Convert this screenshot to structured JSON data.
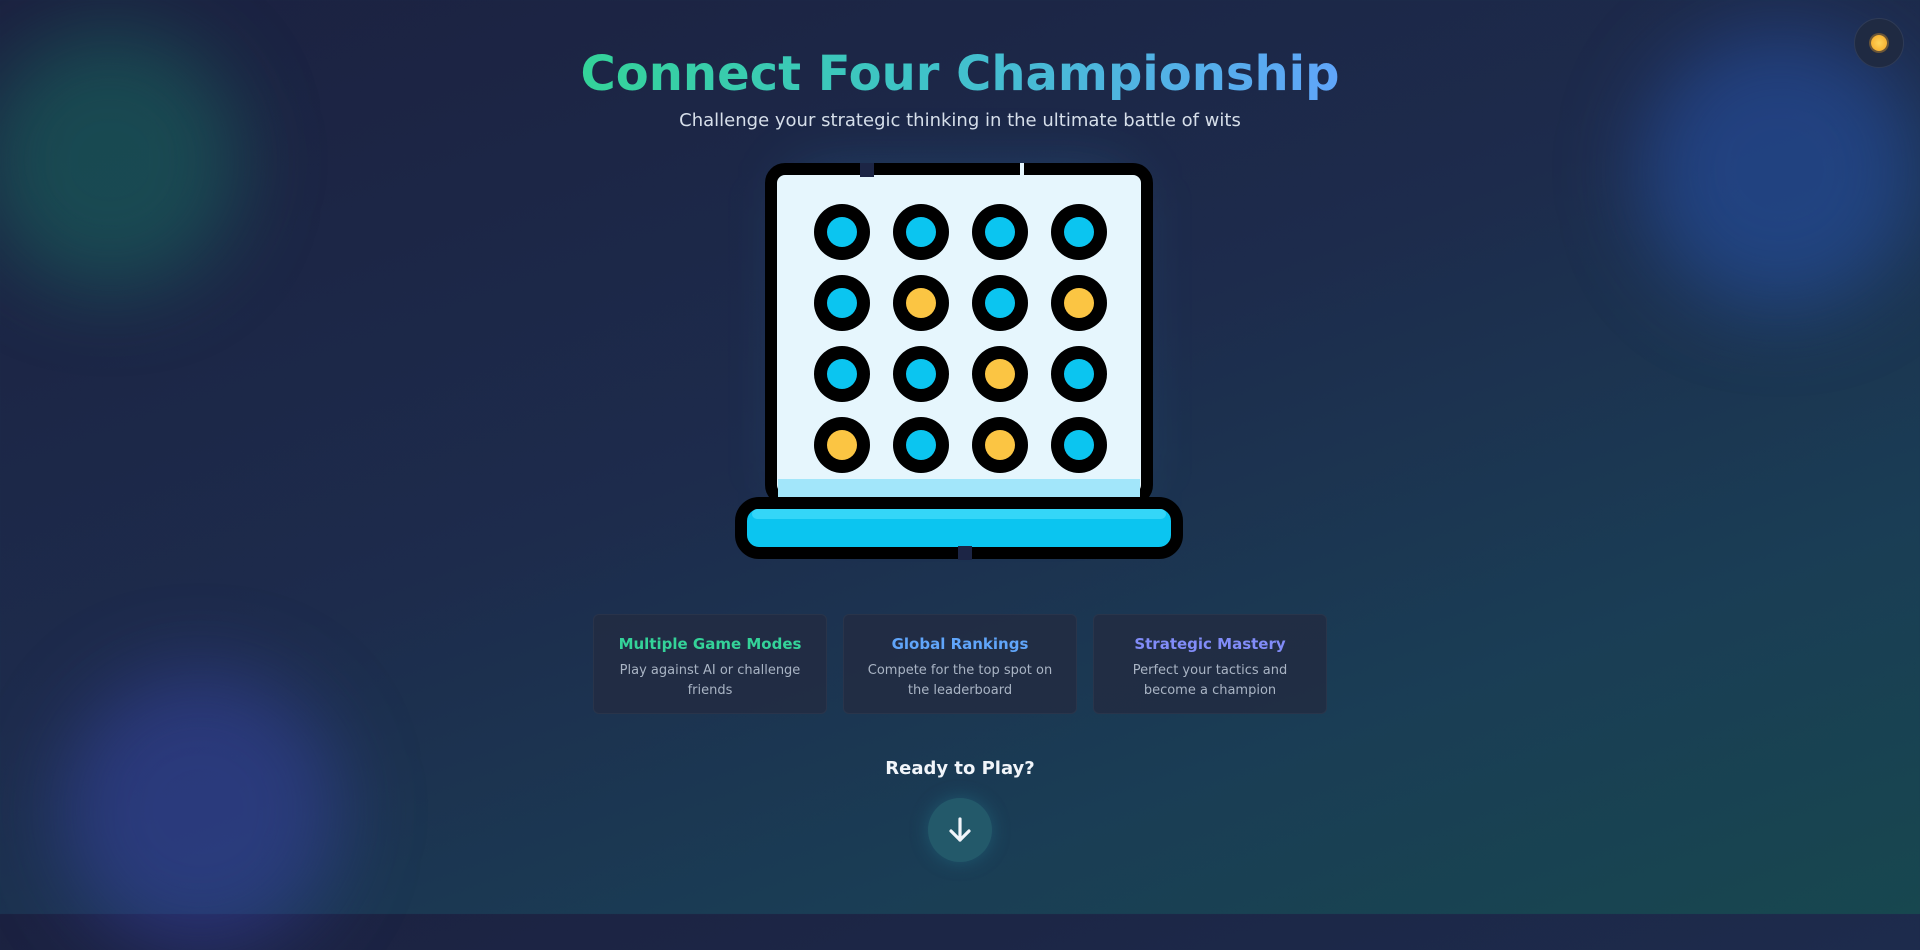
{
  "header": {
    "title": "Connect Four Championship",
    "subtitle": "Challenge your strategic thinking in the ultimate battle of wits"
  },
  "theme_toggle": {
    "icon": "sun-icon"
  },
  "board": {
    "rows": [
      [
        "blue",
        "blue",
        "blue",
        "blue"
      ],
      [
        "blue",
        "yellow",
        "blue",
        "yellow"
      ],
      [
        "blue",
        "blue",
        "yellow",
        "blue"
      ],
      [
        "yellow",
        "blue",
        "yellow",
        "blue"
      ]
    ],
    "colors": {
      "blue": "#0bc5f0",
      "yellow": "#fbc543",
      "frame": "#000000",
      "face": "#e6f6fd"
    }
  },
  "features": [
    {
      "title": "Multiple Game Modes",
      "description": "Play against AI or challenge friends",
      "color": "#34d399"
    },
    {
      "title": "Global Rankings",
      "description": "Compete for the top spot on the leaderboard",
      "color": "#60a5fa"
    },
    {
      "title": "Strategic Mastery",
      "description": "Perfect your tactics and become a champion",
      "color": "#818cf8"
    }
  ],
  "cta": {
    "label": "Ready to Play?",
    "icon": "arrow-down-icon"
  }
}
